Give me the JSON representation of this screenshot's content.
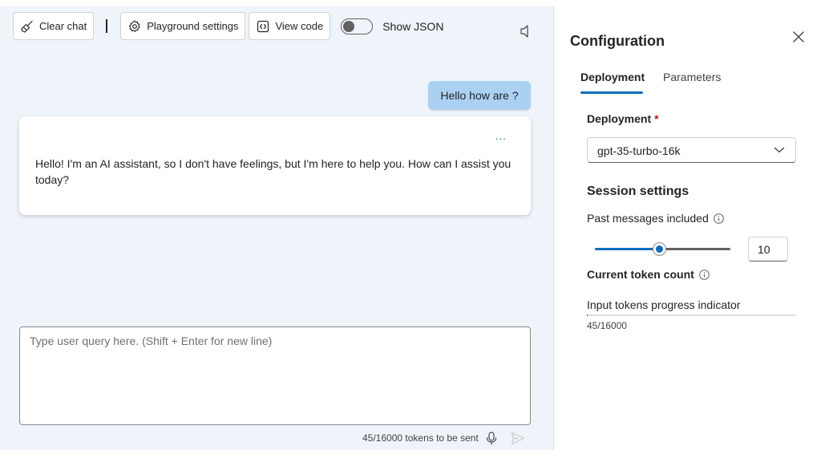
{
  "toolbar": {
    "clear_chat": "Clear chat",
    "playground_settings": "Playground settings",
    "view_code": "View code",
    "show_json": "Show JSON",
    "show_json_on": false
  },
  "chat": {
    "user_message": "Hello how are ?",
    "assistant_message": "Hello! I'm an AI assistant, so I don't have feelings, but I'm here to help you. How can I assist you today?",
    "more_options": "...",
    "input_placeholder": "Type user query here. (Shift + Enter for new line)",
    "input_value": "",
    "tokens_to_send": "45/16000 tokens to be sent"
  },
  "config": {
    "title": "Configuration",
    "tabs": [
      {
        "label": "Deployment",
        "active": true
      },
      {
        "label": "Parameters",
        "active": false
      }
    ],
    "deployment_label": "Deployment",
    "required_mark": "*",
    "deployment_value": "gpt-35-turbo-16k",
    "session_title": "Session settings",
    "past_messages_label": "Past messages included",
    "past_messages_value": "10",
    "past_messages_min": 1,
    "past_messages_max": 20,
    "token_count_label": "Current token count",
    "progress_label": "Input tokens progress indicator",
    "progress_text": "45/16000",
    "progress_fraction": 0.0028
  },
  "colors": {
    "accent": "#0f6cbd",
    "chat_background": "#eff4fb",
    "user_bubble": "#abd1f2",
    "required": "#c50f1f"
  },
  "icons": [
    "broom-icon",
    "gear-icon",
    "code-icon",
    "speaker-icon",
    "microphone-icon",
    "send-icon",
    "close-icon",
    "chevron-down-icon",
    "info-icon"
  ]
}
